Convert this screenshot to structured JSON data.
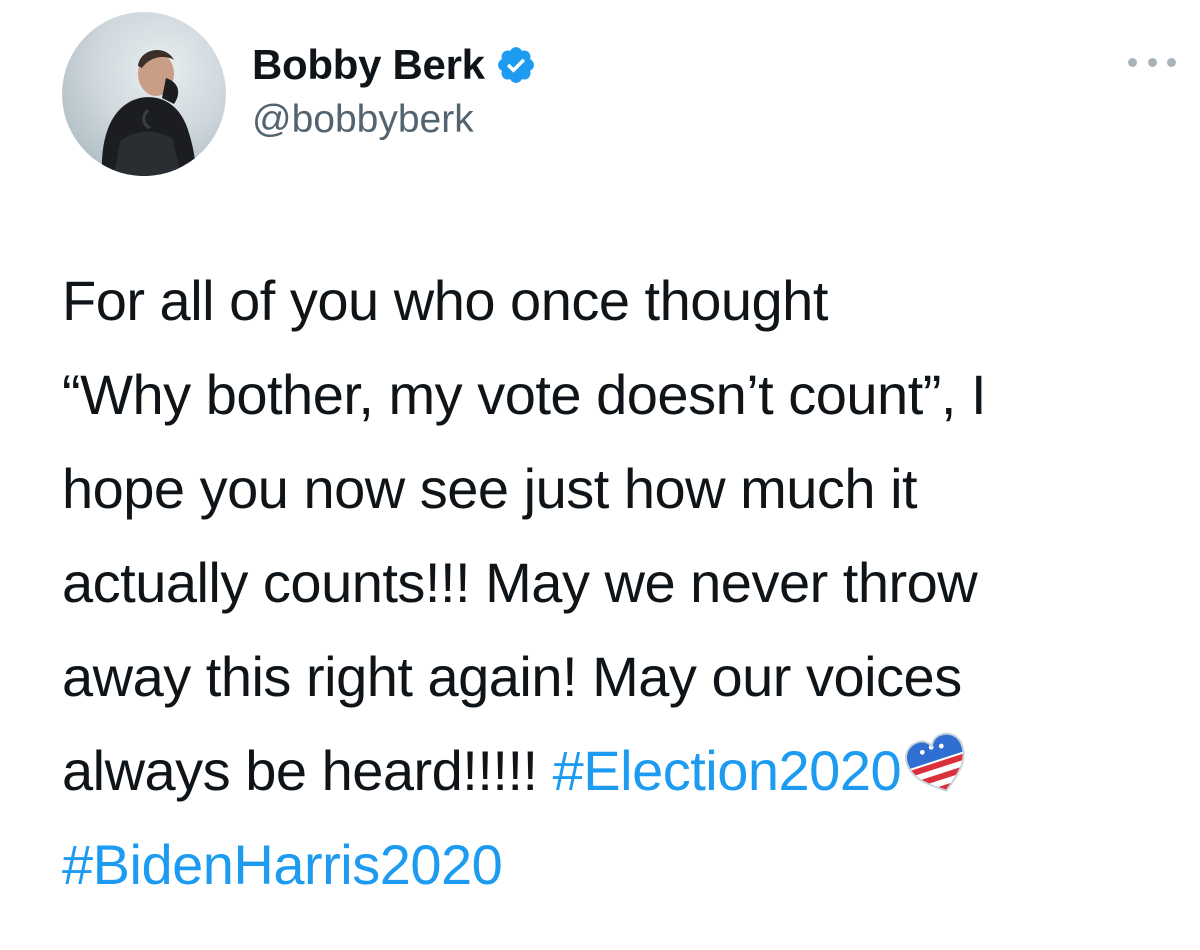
{
  "tweet": {
    "author": {
      "display_name": "Bobby Berk",
      "handle": "@bobbyberk",
      "avatar": "avatar-photo",
      "verified_icon": "verified-badge-icon"
    },
    "menu_icon": "more-options-icon",
    "text_lines": [
      "For all of you who once thought",
      "“Why bother, my vote doesn’t count”, I",
      "hope you now see just how much it",
      "actually counts!!! May we never throw",
      "away this right again! May our voices",
      "always be heard!!!!! "
    ],
    "hashtags": [
      "#Election2020",
      "#BidenHarris2020"
    ],
    "emoji_icon": "usa-ballot-heart-emoji",
    "colors": {
      "text": "#0f1419",
      "handle": "#536471",
      "link": "#1d9bf0",
      "verified": "#1d9bf0"
    }
  }
}
